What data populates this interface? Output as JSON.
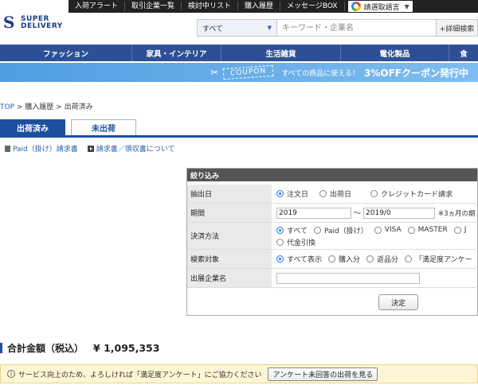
{
  "topbar": {
    "links": [
      "入荷アラート",
      "取引企業一覧",
      "検討中リスト",
      "購入履歴",
      "メッセージBOX"
    ],
    "translate_label": "請選取語言"
  },
  "logo": {
    "line1": "SUPER",
    "line2": "DELIVERY"
  },
  "search": {
    "category": "すべて",
    "placeholder": "キーワード・企業名",
    "advanced": "+詳細検索"
  },
  "nav": {
    "items": [
      "ファッション",
      "家具・インテリア",
      "生活雑貨",
      "電化製品",
      "食"
    ]
  },
  "banner": {
    "coupon": "COUPON",
    "message": "すべての商品に使える！",
    "highlight": "3%OFFクーポン発行中"
  },
  "breadcrumb": {
    "top": "TOP",
    "mid": "購入履歴",
    "current": "出荷済み",
    "sep": " > "
  },
  "tabs": {
    "shipped": "出荷済み",
    "unshipped": "未出荷"
  },
  "sublinks": {
    "paid_invoice": "Paid（掛け）請求書",
    "receipt_info": "請求書／領収書について"
  },
  "filter": {
    "title": "絞り込み",
    "rows": {
      "date_type": {
        "label": "抽出日",
        "options": [
          "注文日",
          "出荷日",
          "クレジットカード請求"
        ],
        "selected": 0
      },
      "period": {
        "label": "期間",
        "from": "2019",
        "sep": "〜",
        "to": "2019/0",
        "note": "※3ヵ月の期"
      },
      "payment": {
        "label": "決済方法",
        "options": [
          "すべて",
          "Paid（掛け）",
          "VISA",
          "MASTER",
          "J",
          "代金引換"
        ],
        "selected": 0
      },
      "target": {
        "label": "検索対象",
        "options": [
          "すべて表示",
          "購入分",
          "返品分",
          "「満足度アンケー"
        ],
        "selected": 0
      },
      "company": {
        "label": "出展企業名",
        "value": ""
      }
    },
    "submit": "決定"
  },
  "total": {
    "label": "合計金額（税込）",
    "amount": "¥ 1,095,353"
  },
  "notice": {
    "info_icon": "i",
    "text": "サービス向上のため、よろしければ「満足度アンケート」にご協力ください",
    "button": "アンケート未回答の出荷を見る"
  }
}
